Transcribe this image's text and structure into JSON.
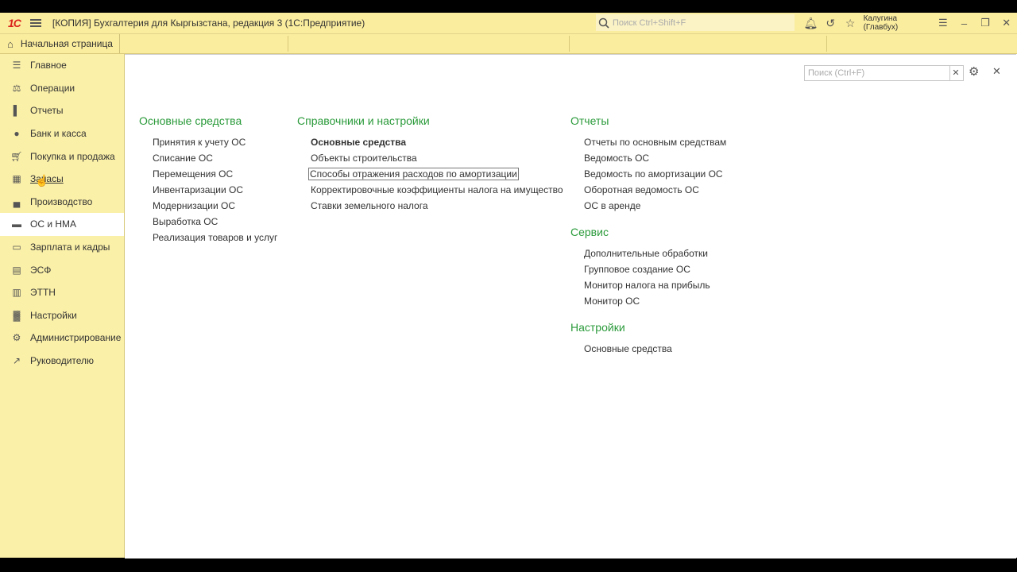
{
  "titlebar": {
    "logo": "1С",
    "title": "[КОПИЯ] Бухгалтерия для Кыргызстана, редакция 3  (1С:Предприятие)",
    "search_placeholder": "Поиск Ctrl+Shift+F",
    "user": "Калугина (Главбух)"
  },
  "home_tab": {
    "label": "Начальная страница"
  },
  "sidebar": {
    "items": [
      {
        "label": "Главное",
        "icon": "list-icon"
      },
      {
        "label": "Операции",
        "icon": "operations-icon"
      },
      {
        "label": "Отчеты",
        "icon": "bar-chart-icon"
      },
      {
        "label": "Банк и касса",
        "icon": "coin-icon"
      },
      {
        "label": "Покупка и продажа",
        "icon": "cart-icon"
      },
      {
        "label": "Запасы",
        "icon": "grid-icon"
      },
      {
        "label": "Производство",
        "icon": "factory-icon"
      },
      {
        "label": "ОС и НМА",
        "icon": "truck-icon"
      },
      {
        "label": "Зарплата и кадры",
        "icon": "card-icon"
      },
      {
        "label": "ЭСФ",
        "icon": "document-icon"
      },
      {
        "label": "ЭТТН",
        "icon": "cart-icon"
      },
      {
        "label": "Настройки",
        "icon": "building-icon"
      },
      {
        "label": "Администрирование",
        "icon": "gear-icon"
      },
      {
        "label": "Руководителю",
        "icon": "trend-icon"
      }
    ]
  },
  "panel": {
    "search_placeholder": "Поиск (Ctrl+F)",
    "columns": [
      {
        "sections": [
          {
            "title": "Основные средства",
            "links": [
              "Принятия к учету ОС",
              "Списание ОС",
              "Перемещения ОС",
              "Инвентаризации ОС",
              "Модернизации ОС",
              "Выработка ОС",
              "Реализация товаров и услуг"
            ]
          }
        ]
      },
      {
        "sections": [
          {
            "title": "Справочники и настройки",
            "links": [
              "Основные средства",
              "Объекты строительства",
              "Способы отражения расходов по амортизации",
              "Корректировочные коэффициенты налога на имущество",
              "Ставки земельного налога"
            ]
          }
        ]
      },
      {
        "sections": [
          {
            "title": "Отчеты",
            "links": [
              "Отчеты по основным средствам",
              "Ведомость ОС",
              "Ведомость по амортизации ОС",
              "Оборотная ведомость ОС",
              "ОС в аренде"
            ]
          },
          {
            "title": "Сервис",
            "links": [
              "Дополнительные обработки",
              "Групповое создание ОС",
              "Монитор налога на прибыль",
              "Монитор ОС"
            ]
          },
          {
            "title": "Настройки",
            "links": [
              "Основные средства"
            ]
          }
        ]
      }
    ]
  },
  "colors": {
    "accent_green": "#2a9a3a",
    "sidebar_bg": "#fbf0a8",
    "titlebar_bg": "#fbed9e"
  }
}
